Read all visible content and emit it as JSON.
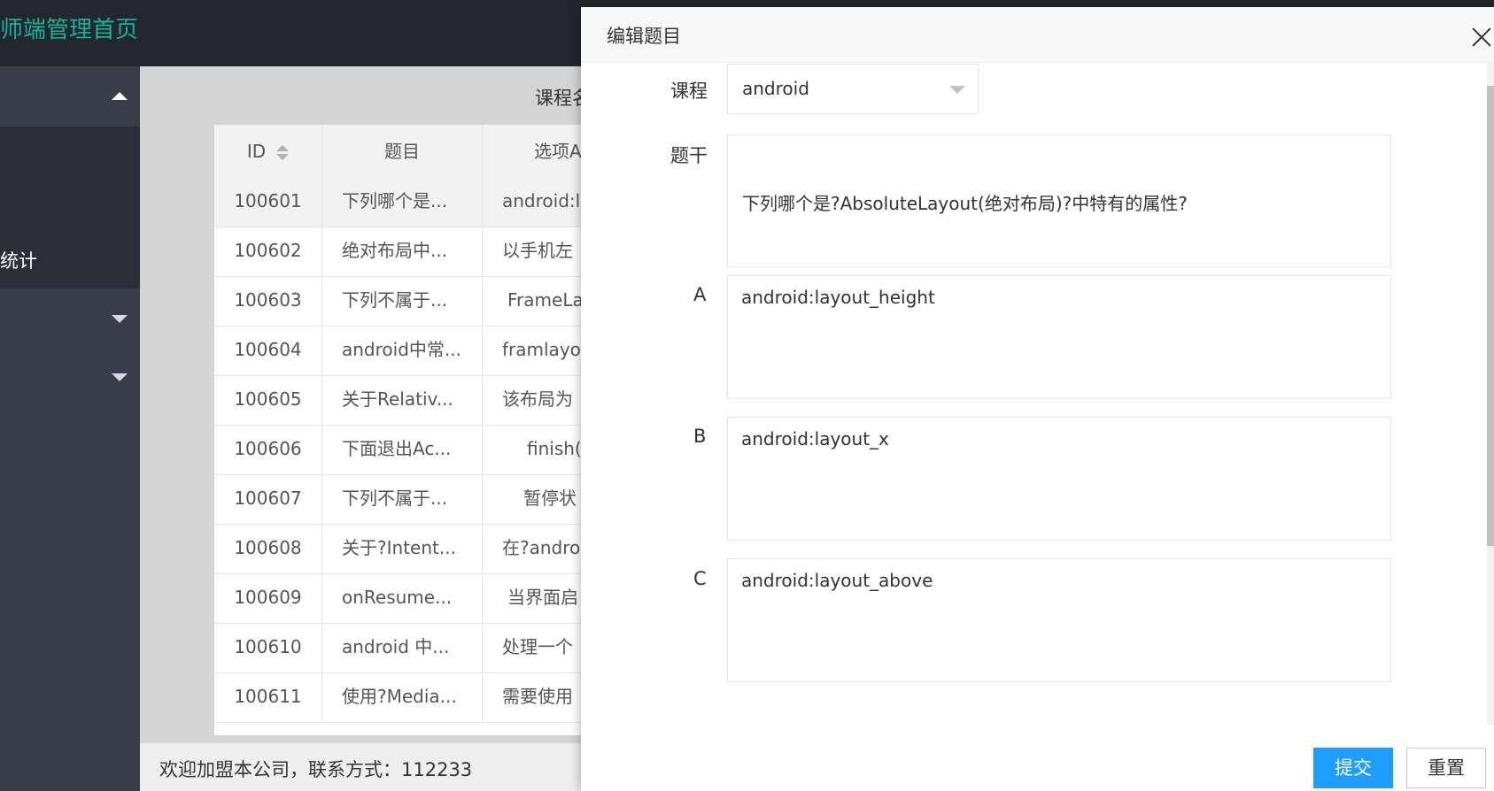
{
  "header": {
    "title": "师端管理首页"
  },
  "sidebar": {
    "active_item": "统计"
  },
  "table": {
    "visible_header_partial": "课程名",
    "columns": [
      "ID",
      "题目",
      "选项A"
    ],
    "rows": [
      {
        "id": "100601",
        "question": "下列哪个是...",
        "option": "android:la"
      },
      {
        "id": "100602",
        "question": "绝对布局中...",
        "option": "以手机左"
      },
      {
        "id": "100603",
        "question": "下列不属于...",
        "option": "FrameLa"
      },
      {
        "id": "100604",
        "question": "android中常...",
        "option": "framlayou"
      },
      {
        "id": "100605",
        "question": "关于Relativ...",
        "option": "该布局为"
      },
      {
        "id": "100606",
        "question": "下面退出Ac...",
        "option": "finish("
      },
      {
        "id": "100607",
        "question": "下列不属于...",
        "option": "暂停状"
      },
      {
        "id": "100608",
        "question": "关于?Intent...",
        "option": "在?andro"
      },
      {
        "id": "100609",
        "question": "onResume...",
        "option": "当界面启"
      },
      {
        "id": "100610",
        "question": "android 中...",
        "option": "处理一个"
      },
      {
        "id": "100611",
        "question": "使用?Media...",
        "option": "需要使用"
      }
    ]
  },
  "footer": {
    "text": "欢迎加盟本公司，联系方式：112233"
  },
  "modal": {
    "title": "编辑题目",
    "labels": {
      "course": "课程",
      "stem": "题干",
      "a": "A",
      "b": "B",
      "c": "C"
    },
    "course_value": "android",
    "stem_value": "下列哪个是?AbsoluteLayout(绝对布局)?中特有的属性?",
    "option_a": "android:layout_height",
    "option_b": "android:layout_x",
    "option_c": "android:layout_above",
    "submit_label": "提交",
    "reset_label": "重置"
  },
  "colors": {
    "accent": "#16b39b",
    "primary_button": "#1e9fff",
    "topbar": "#23262e",
    "sidebar": "#393d49"
  }
}
